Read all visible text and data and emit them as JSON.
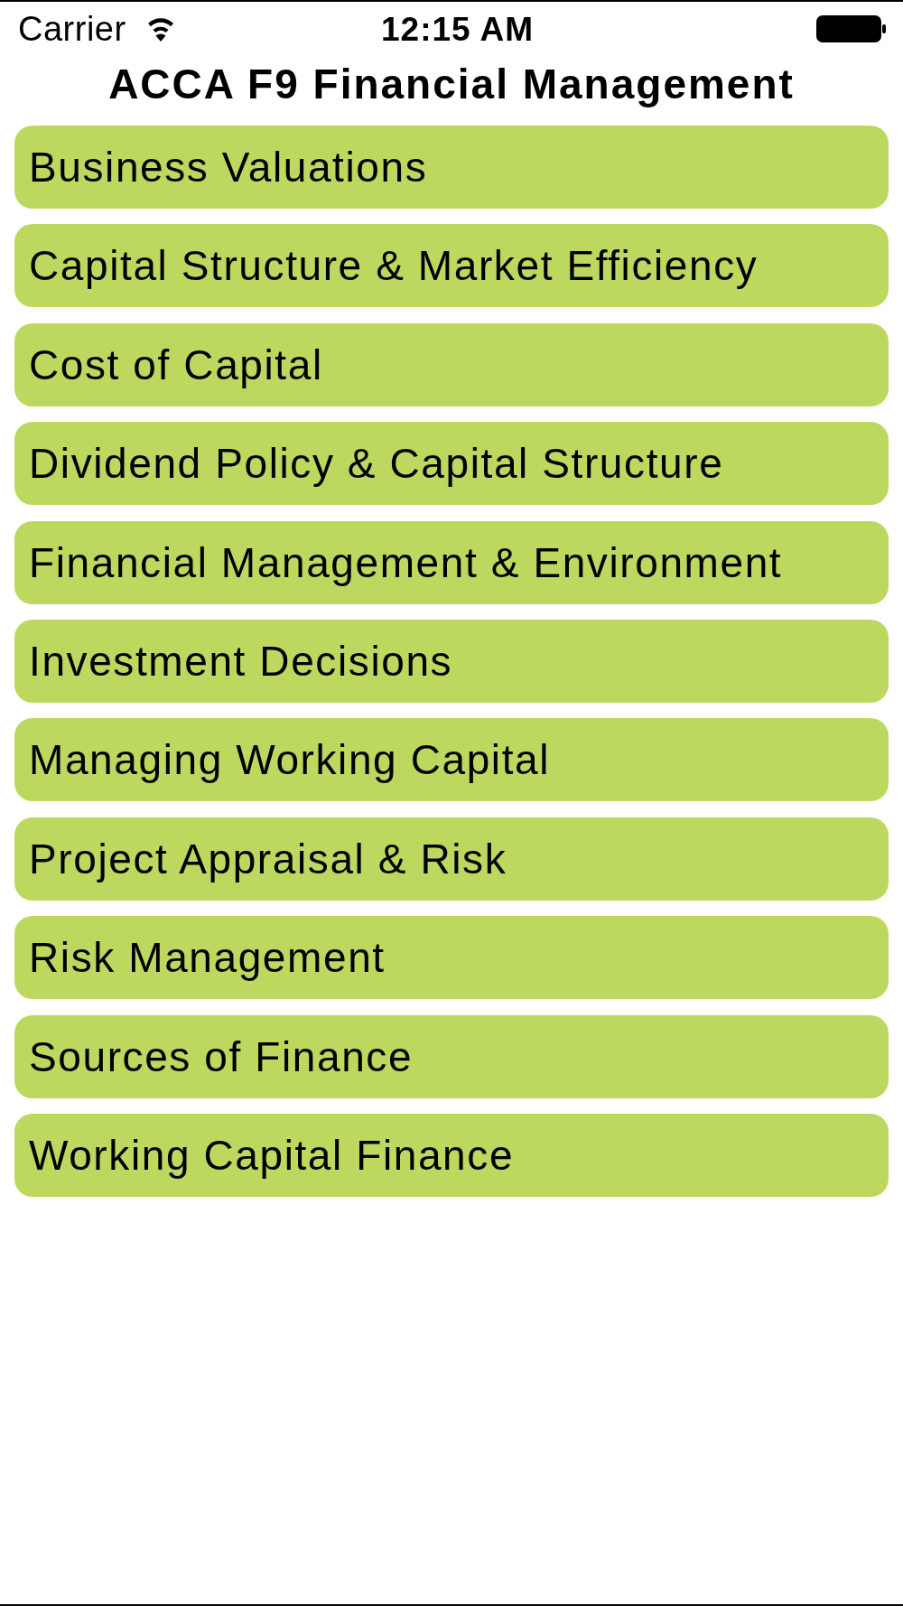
{
  "status_bar": {
    "carrier": "Carrier",
    "time": "12:15 AM"
  },
  "title": "ACCA F9 Financial Management",
  "topics": [
    "Business Valuations",
    "Capital Structure & Market Efficiency",
    "Cost of Capital",
    "Dividend Policy & Capital Structure",
    "Financial Management & Environment",
    "Investment Decisions",
    "Managing Working Capital",
    "Project Appraisal & Risk",
    "Risk Management",
    "Sources of Finance",
    "Working Capital Finance"
  ]
}
